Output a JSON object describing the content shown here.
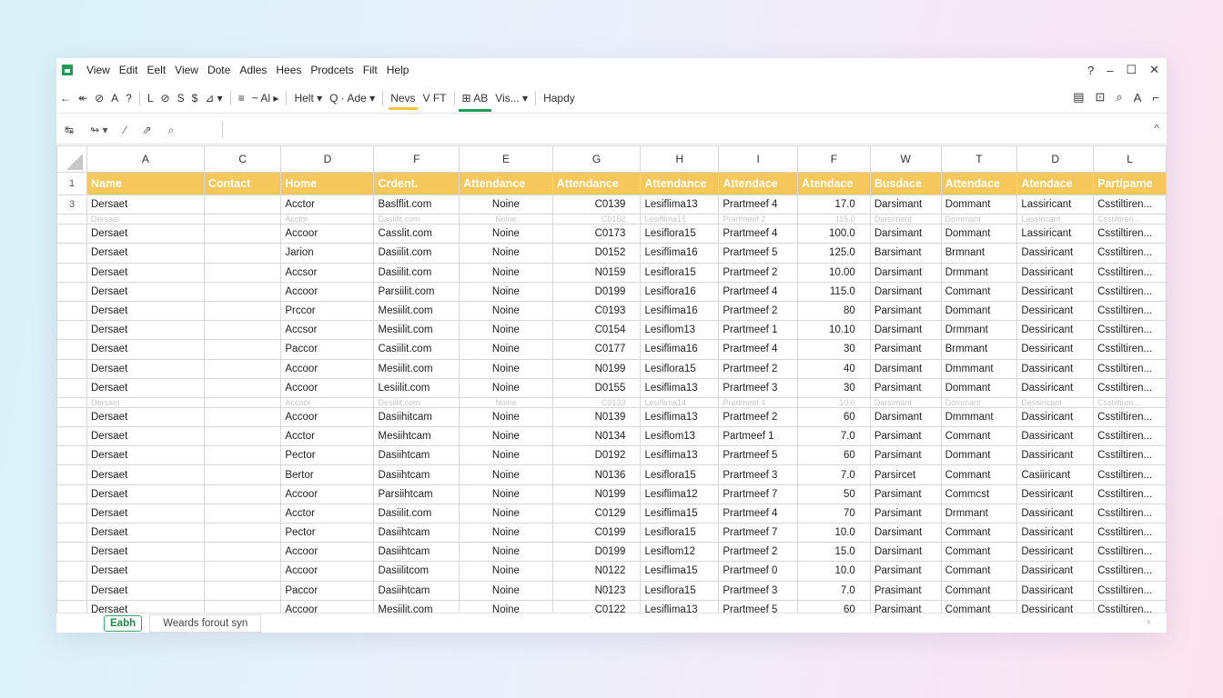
{
  "menubar": {
    "items": [
      "View",
      "Edit",
      "Eelt",
      "View",
      "Dote",
      "Adles",
      "Hees",
      "Prodcets",
      "Filt",
      "Help"
    ],
    "controls": [
      "?",
      "–",
      "☐",
      "✕"
    ]
  },
  "toolbar": {
    "items": [
      {
        "label": "←",
        "name": "back-arrow-icon"
      },
      {
        "label": "↞",
        "name": "undo-icon"
      },
      {
        "label": "⊘",
        "name": "paint-format-icon"
      },
      {
        "label": "A",
        "name": "font-icon"
      },
      {
        "label": "?",
        "name": "help-icon"
      },
      {
        "label": "L",
        "name": "align-left-icon"
      },
      {
        "label": "⊘",
        "name": "erase-icon"
      },
      {
        "label": "S",
        "name": "style-icon"
      },
      {
        "label": "$",
        "name": "currency-icon"
      },
      {
        "label": "⊿ ▾",
        "name": "fill-color-icon"
      },
      {
        "label": "≡",
        "name": "lines-icon"
      },
      {
        "label": "~ Al ▸",
        "name": "text-align-menu"
      },
      {
        "label": "Helt ▾",
        "name": "font-family-dropdown"
      },
      {
        "label": "Q · Ade ▾",
        "name": "zoom-dropdown"
      },
      {
        "label": "Nevs",
        "name": "news-tab"
      },
      {
        "label": "V FT",
        "name": "view-filter-button"
      },
      {
        "label": "⊞ AB",
        "name": "table-view-tab"
      },
      {
        "label": "Vis... ▾",
        "name": "visibility-dropdown"
      },
      {
        "label": "Hapdy",
        "name": "happy-button"
      }
    ],
    "right_icons": [
      "document-icon",
      "user-icon",
      "search-icon",
      "font-size-icon",
      "more-icon"
    ],
    "right_glyphs": [
      "▤",
      "⊡",
      "⌕",
      "A",
      "⌐"
    ]
  },
  "formula": {
    "icons": [
      "↹",
      "↬ ▾",
      "⁄",
      "⇗",
      "⌕"
    ],
    "collapse": "^"
  },
  "grid": {
    "columns": [
      "A",
      "C",
      "D",
      "F",
      "E",
      "G",
      "H",
      "I",
      "F",
      "W",
      "T",
      "D",
      "L"
    ],
    "header_row_num": "1",
    "headers": [
      "Name",
      "Contact",
      "Home",
      "Crdent.",
      "Attendance",
      "Attendance",
      "Attendance",
      "Attendace",
      "Atendace",
      "Busdace",
      "Attendace",
      "Atendace",
      "Partipame"
    ],
    "first_row_num": "3",
    "rows": [
      {
        "faded": false,
        "cells": [
          "Dersaet",
          "",
          "Acctor",
          "Baslflit.com",
          "Noine",
          "C0139",
          "Lesiflima13",
          "Prartmeef 4",
          "17.0",
          "Darsimant",
          "Dommant",
          "Lassiricant",
          "Csstiltiren..."
        ]
      },
      {
        "faded": true,
        "cells": [
          "Dersaet",
          "",
          "Acctor",
          "Dasiilit.com",
          "Noine",
          "C0152",
          "Lesiflima15",
          "Prartmeef 2",
          "115.0",
          "Darsimant",
          "Dommant",
          "Lassiricant",
          "Csstiltiren..."
        ]
      },
      {
        "faded": false,
        "cells": [
          "Dersaet",
          "",
          "Accoor",
          "Casslit.com",
          "Noine",
          "C0173",
          "Lesiflora15",
          "Prartmeef 4",
          "100.0",
          "Darsimant",
          "Dommant",
          "Lassiricant",
          "Csstiltiren..."
        ]
      },
      {
        "faded": false,
        "cells": [
          "Dersaet",
          "",
          "Jarion",
          "Dasiilit.com",
          "Noine",
          "D0152",
          "Lesiflima16",
          "Prartmeef 5",
          "125.0",
          "Barsimant",
          "Brmnant",
          "Dassiricant",
          "Csstiltiren..."
        ]
      },
      {
        "faded": false,
        "cells": [
          "Dersaet",
          "",
          "Accsor",
          "Dasiilit.com",
          "Noine",
          "N0159",
          "Lesiflora15",
          "Prartmeef 2",
          "10.00",
          "Darsimant",
          "Drmmant",
          "Dassiricant",
          "Csstiltiren..."
        ]
      },
      {
        "faded": false,
        "cells": [
          "Dersaet",
          "",
          "Accoor",
          "Parsiilit.com",
          "Noine",
          "D0199",
          "Lesiflora16",
          "Prartmeef 4",
          "115.0",
          "Darsimant",
          "Commant",
          "Dessiricant",
          "Csstiltiren..."
        ]
      },
      {
        "faded": false,
        "cells": [
          "Dersaet",
          "",
          "Prccor",
          "Mesiilit.com",
          "Noine",
          "C0193",
          "Lesiflima16",
          "Prartmeef 2",
          "80",
          "Parsimant",
          "Dommant",
          "Dessiricant",
          "Csstiltiren..."
        ]
      },
      {
        "faded": false,
        "cells": [
          "Dersaet",
          "",
          "Accsor",
          "Mesiilit.com",
          "Noine",
          "C0154",
          "Lesiflom13",
          "Prartmeef 1",
          "10.10",
          "Darsimant",
          "Drmmant",
          "Dessiricant",
          "Csstiltiren..."
        ]
      },
      {
        "faded": false,
        "cells": [
          "Dersaet",
          "",
          "Paccor",
          "Casiilit.com",
          "Noine",
          "C0177",
          "Lesiflima16",
          "Prartmeef 4",
          "30",
          "Parsimant",
          "Brmmant",
          "Dessiricant",
          "Csstiltiren..."
        ]
      },
      {
        "faded": false,
        "cells": [
          "Dersaet",
          "",
          "Accoor",
          "Mesiilit.com",
          "Noine",
          "N0199",
          "Lesiflora15",
          "Prartmeef 2",
          "40",
          "Darsimant",
          "Dmmmant",
          "Dassiricant",
          "Csstiltiren..."
        ]
      },
      {
        "faded": false,
        "cells": [
          "Dersaet",
          "",
          "Accoor",
          "Lesiilit.com",
          "Noine",
          "D0155",
          "Lesiflima13",
          "Prartmeef 3",
          "30",
          "Parsimant",
          "Dommant",
          "Dassiricant",
          "Csstiltiren..."
        ]
      },
      {
        "faded": true,
        "cells": [
          "Dersaet",
          "",
          "Accoor",
          "Desiilit.com",
          "Noine",
          "C0133",
          "Lesiflima14",
          "Prartmeef 4",
          "10.0",
          "Darsimant",
          "Dommant",
          "Dessiricant",
          "Csstiltiren..."
        ]
      },
      {
        "faded": false,
        "cells": [
          "Dersaet",
          "",
          "Accoor",
          "Dasiihitcam",
          "Noine",
          "N0139",
          "Lesiflima13",
          "Prartmeef 2",
          "60",
          "Darsimant",
          "Dmmmant",
          "Dassiricant",
          "Csstiltiren..."
        ]
      },
      {
        "faded": false,
        "cells": [
          "Dersaet",
          "",
          "Acctor",
          "Mesiihtcam",
          "Noine",
          "N0134",
          "Lesiflom13",
          "Partmeef 1",
          "7.0",
          "Parsimant",
          "Commant",
          "Dassiricant",
          "Csstiltiren..."
        ]
      },
      {
        "faded": false,
        "cells": [
          "Dersaet",
          "",
          "Pector",
          "Dasiihtcam",
          "Noine",
          "D0192",
          "Lesiflima13",
          "Prartmeef 5",
          "60",
          "Parsimant",
          "Dommant",
          "Dassiricant",
          "Csstiltiren..."
        ]
      },
      {
        "faded": false,
        "cells": [
          "Dersaet",
          "",
          "Bertor",
          "Dasiihtcam",
          "Noine",
          "N0136",
          "Lesiflora15",
          "Prartmeef 3",
          "7.0",
          "Parsircet",
          "Commant",
          "Casiiricant",
          "Csstiltiren..."
        ]
      },
      {
        "faded": false,
        "cells": [
          "Dersaet",
          "",
          "Accoor",
          "Parsiihtcam",
          "Noine",
          "N0199",
          "Lesiflima12",
          "Prartmeef 7",
          "50",
          "Parsimant",
          "Commcst",
          "Dessiricant",
          "Csstiltiren..."
        ]
      },
      {
        "faded": false,
        "cells": [
          "Dersaet",
          "",
          "Acctor",
          "Dasiilit.com",
          "Noine",
          "C0129",
          "Lesiflima15",
          "Prartmeef 4",
          "70",
          "Parsimant",
          "Drmmant",
          "Dassiricant",
          "Csstiltiren..."
        ]
      },
      {
        "faded": false,
        "cells": [
          "Dersaet",
          "",
          "Pector",
          "Dasiihtcam",
          "Noine",
          "C0199",
          "Lesiflora15",
          "Prartmeef 7",
          "10.0",
          "Darsimant",
          "Commant",
          "Dassiricant",
          "Csstiltiren..."
        ]
      },
      {
        "faded": false,
        "cells": [
          "Dersaet",
          "",
          "Accoor",
          "Dasiihtcam",
          "Noine",
          "D0199",
          "Lesiflom12",
          "Prartmeef 2",
          "15.0",
          "Darsimant",
          "Commant",
          "Dessiricant",
          "Csstiltiren..."
        ]
      },
      {
        "faded": false,
        "cells": [
          "Dersaet",
          "",
          "Accoor",
          "Dasiilitcom",
          "Noine",
          "N0122",
          "Lesiflima15",
          "Prartmeef 0",
          "10.0",
          "Parsimant",
          "Commant",
          "Dassiricant",
          "Csstiltiren..."
        ]
      },
      {
        "faded": false,
        "cells": [
          "Dersaet",
          "",
          "Paccor",
          "Dasiihtcam",
          "Noine",
          "N0123",
          "Lesiflora15",
          "Prartmeef 3",
          "7.0",
          "Prasimant",
          "Commant",
          "Dassiricant",
          "Csstiltiren..."
        ]
      },
      {
        "faded": false,
        "cells": [
          "Dersaet",
          "",
          "Accoor",
          "Mesiilit.com",
          "Noine",
          "C0122",
          "Lesiflima13",
          "Prartmeef 5",
          "60",
          "Parsimant",
          "Commant",
          "Dessiricant",
          "Csstiltiren..."
        ]
      }
    ]
  },
  "sheets": {
    "active": "Eabh",
    "other": "Weards forout syn",
    "scroll_hint": "›"
  },
  "colors": {
    "header_fill": "#f6c75a",
    "accent_green": "#1f9d55",
    "accent_yellow": "#f4c542"
  }
}
